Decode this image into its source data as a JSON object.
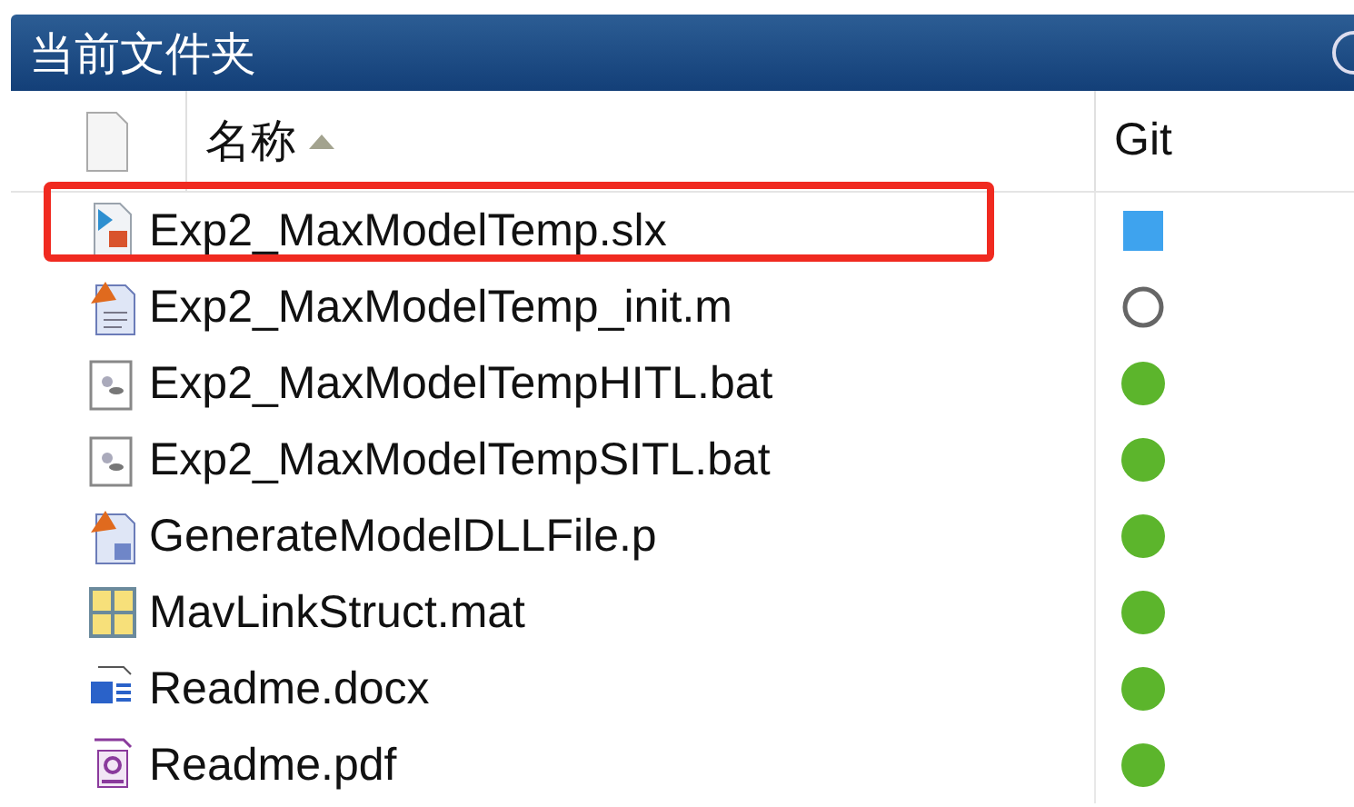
{
  "panel": {
    "title": "当前文件夹"
  },
  "columns": [
    {
      "label": "名称",
      "sorted": true
    },
    {
      "label": "Git",
      "sorted": false
    }
  ],
  "files": [
    {
      "name": "Exp2_MaxModelTemp.slx",
      "kind": "slx",
      "git": {
        "kind": "modified"
      },
      "highlighted": true
    },
    {
      "name": "Exp2_MaxModelTemp_init.m",
      "kind": "m",
      "git": {
        "kind": "untracked"
      },
      "highlighted": false
    },
    {
      "name": "Exp2_MaxModelTempHITL.bat",
      "kind": "bat",
      "git": {
        "kind": "unmodified"
      },
      "highlighted": false
    },
    {
      "name": "Exp2_MaxModelTempSITL.bat",
      "kind": "bat",
      "git": {
        "kind": "unmodified"
      },
      "highlighted": false
    },
    {
      "name": "GenerateModelDLLFile.p",
      "kind": "p",
      "git": {
        "kind": "unmodified"
      },
      "highlighted": false
    },
    {
      "name": "MavLinkStruct.mat",
      "kind": "mat",
      "git": {
        "kind": "unmodified"
      },
      "highlighted": false
    },
    {
      "name": "Readme.docx",
      "kind": "docx",
      "git": {
        "kind": "unmodified"
      },
      "highlighted": false
    },
    {
      "name": "Readme.pdf",
      "kind": "pdf",
      "git": {
        "kind": "unmodified"
      },
      "highlighted": false
    }
  ]
}
